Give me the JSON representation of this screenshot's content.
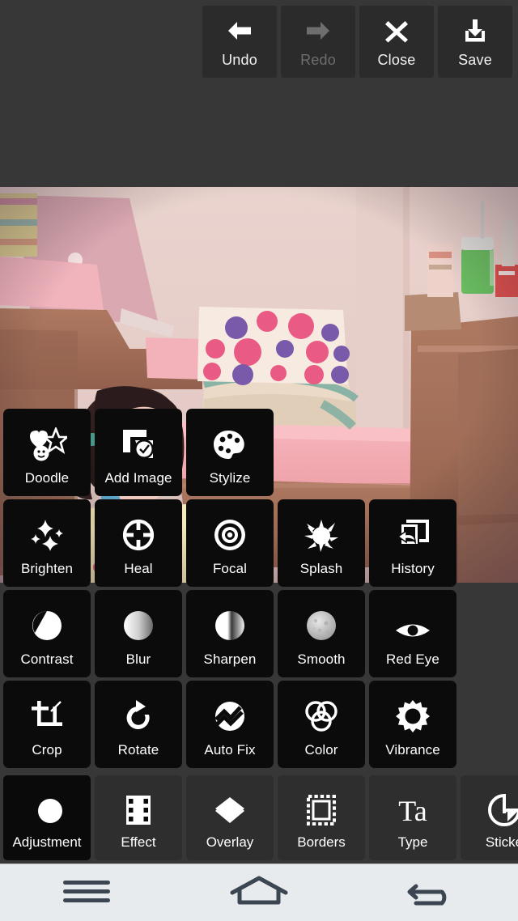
{
  "app": {
    "background_color": "#373737",
    "tile_color": "#0b0b0b",
    "category_color": "#2e2e2e",
    "navbar_color": "#e7ebee",
    "label_color": "#ffffff"
  },
  "toolbar": {
    "buttons": [
      {
        "label": "Undo",
        "icon": "arrow-left-icon",
        "enabled": true
      },
      {
        "label": "Redo",
        "icon": "arrow-right-icon",
        "enabled": false
      },
      {
        "label": "Close",
        "icon": "close-x-icon",
        "enabled": true
      },
      {
        "label": "Save",
        "icon": "save-download-icon",
        "enabled": true
      }
    ]
  },
  "canvas": {
    "name": "photo-canvas",
    "description": "Photo of a young child seated in front of a pink bench with a polka-dot pillow, wooden furniture and a green tumbler on a cabinet"
  },
  "tool_grid": {
    "rows": [
      {
        "tiles": [
          {
            "label": "Doodle",
            "icon": "doodle-icon"
          },
          {
            "label": "Add Image",
            "icon": "add-image-icon"
          },
          {
            "label": "Stylize",
            "icon": "palette-icon"
          }
        ]
      },
      {
        "tiles": [
          {
            "label": "Brighten",
            "icon": "sparkle-icon"
          },
          {
            "label": "Heal",
            "icon": "crosshair-icon"
          },
          {
            "label": "Focal",
            "icon": "concentric-circles-icon"
          },
          {
            "label": "Splash",
            "icon": "splash-icon"
          },
          {
            "label": "History",
            "icon": "history-undo-icon"
          }
        ]
      },
      {
        "tiles": [
          {
            "label": "Contrast",
            "icon": "contrast-circle-icon"
          },
          {
            "label": "Blur",
            "icon": "blur-circle-icon"
          },
          {
            "label": "Sharpen",
            "icon": "sharpen-circle-icon"
          },
          {
            "label": "Smooth",
            "icon": "smooth-circle-icon"
          },
          {
            "label": "Red Eye",
            "icon": "eye-icon"
          }
        ]
      },
      {
        "tiles": [
          {
            "label": "Crop",
            "icon": "crop-icon"
          },
          {
            "label": "Rotate",
            "icon": "rotate-cw-icon"
          },
          {
            "label": "Auto Fix",
            "icon": "auto-fix-wave-icon"
          },
          {
            "label": "Color",
            "icon": "color-venn-icon"
          },
          {
            "label": "Vibrance",
            "icon": "sun-burst-icon"
          }
        ]
      }
    ]
  },
  "category_strip": {
    "selected": "Adjustment",
    "items": [
      {
        "label": "Adjustment",
        "icon": "adjustment-circles-icon",
        "selected": true
      },
      {
        "label": "Effect",
        "icon": "film-strip-icon",
        "selected": false
      },
      {
        "label": "Overlay",
        "icon": "layers-diamond-icon",
        "selected": false
      },
      {
        "label": "Borders",
        "icon": "border-frame-icon",
        "selected": false
      },
      {
        "label": "Type",
        "icon": "text-type-icon",
        "selected": false
      },
      {
        "label": "Sticke",
        "icon": "sticker-icon",
        "selected": false
      }
    ]
  },
  "navbar": {
    "buttons": [
      {
        "name": "menu",
        "icon": "hamburger-menu-icon"
      },
      {
        "name": "home",
        "icon": "home-icon"
      },
      {
        "name": "back",
        "icon": "back-arrow-icon"
      }
    ]
  }
}
